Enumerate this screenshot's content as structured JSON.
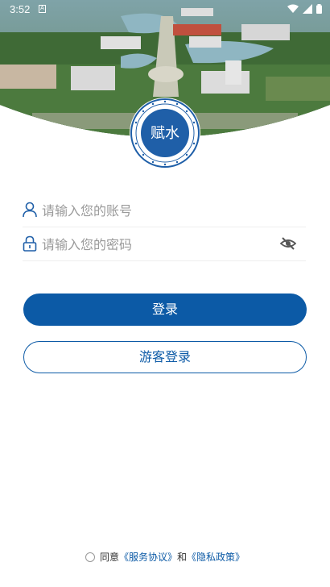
{
  "status_bar": {
    "time": "3:52",
    "notification_icon": "A"
  },
  "logo": {
    "seal_text": "赋水"
  },
  "form": {
    "account_placeholder": "请输入您的账号",
    "password_placeholder": "请输入您的密码"
  },
  "buttons": {
    "login_label": "登录",
    "guest_label": "游客登录"
  },
  "agreement": {
    "prefix": "同意",
    "service_link": "《服务协议》",
    "conjunction": "和",
    "privacy_link": "《隐私政策》"
  },
  "colors": {
    "primary": "#0c5aa6",
    "placeholder": "#9a9a9a"
  }
}
